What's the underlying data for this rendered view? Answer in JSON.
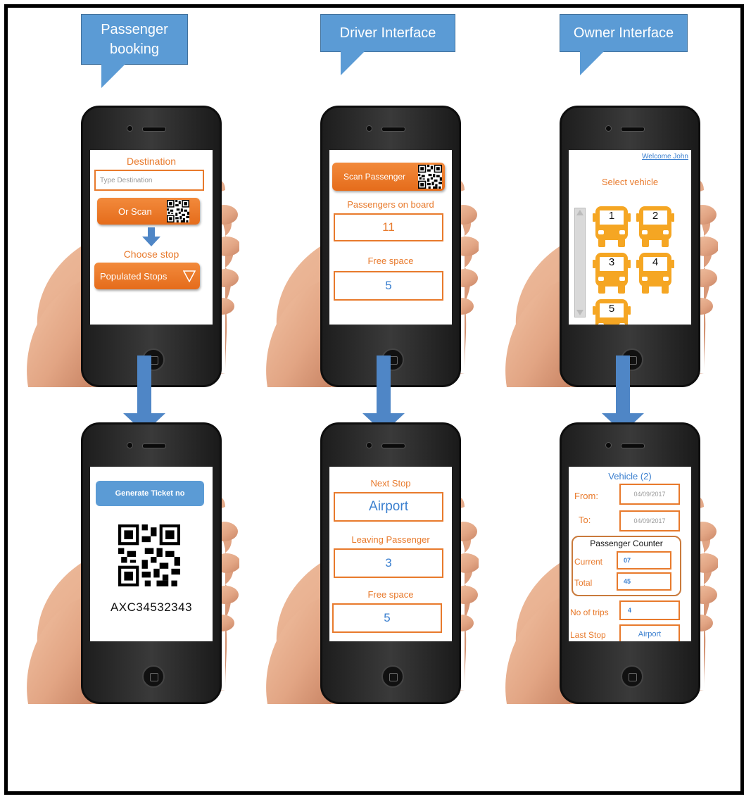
{
  "callouts": {
    "passenger": "Passenger booking",
    "driver": "Driver Interface",
    "owner": "Owner Interface"
  },
  "passenger_booking": {
    "destination_label": "Destination",
    "destination_placeholder": "Type Destination",
    "scan_button": "Or Scan",
    "choose_stop_label": "Choose stop",
    "stops_dropdown": "Populated Stops"
  },
  "passenger_ticket": {
    "generate_button": "Generate Ticket no",
    "ticket_number": "AXC34532343"
  },
  "driver_main": {
    "scan_button": "Scan Passenger",
    "on_board_label": "Passengers on board",
    "on_board_value": "11",
    "free_space_label": "Free space",
    "free_space_value": "5"
  },
  "driver_stop": {
    "next_stop_label": "Next Stop",
    "next_stop_value": "Airport",
    "leaving_label": "Leaving Passenger",
    "leaving_value": "3",
    "free_space_label": "Free space",
    "free_space_value": "5"
  },
  "owner_main": {
    "welcome_link": "Welcome John",
    "select_label": "Select vehicle",
    "vehicles": [
      "1",
      "2",
      "3",
      "4",
      "5"
    ]
  },
  "owner_detail": {
    "title": "Vehicle (2)",
    "from_label": "From:",
    "from_value": "04/09/2017",
    "to_label": "To:",
    "to_value": "04/09/2017",
    "counter_title": "Passenger Counter",
    "current_label": "Current",
    "current_value": "07",
    "total_label": "Total",
    "total_value": "45",
    "trips_label": "No of trips",
    "trips_value": "4",
    "last_stop_label": "Last Stop",
    "last_stop_value": "Airport"
  },
  "colors": {
    "accent_orange": "#e87a2c",
    "accent_blue": "#5b9bd5",
    "bus_yellow": "#f5a623"
  }
}
